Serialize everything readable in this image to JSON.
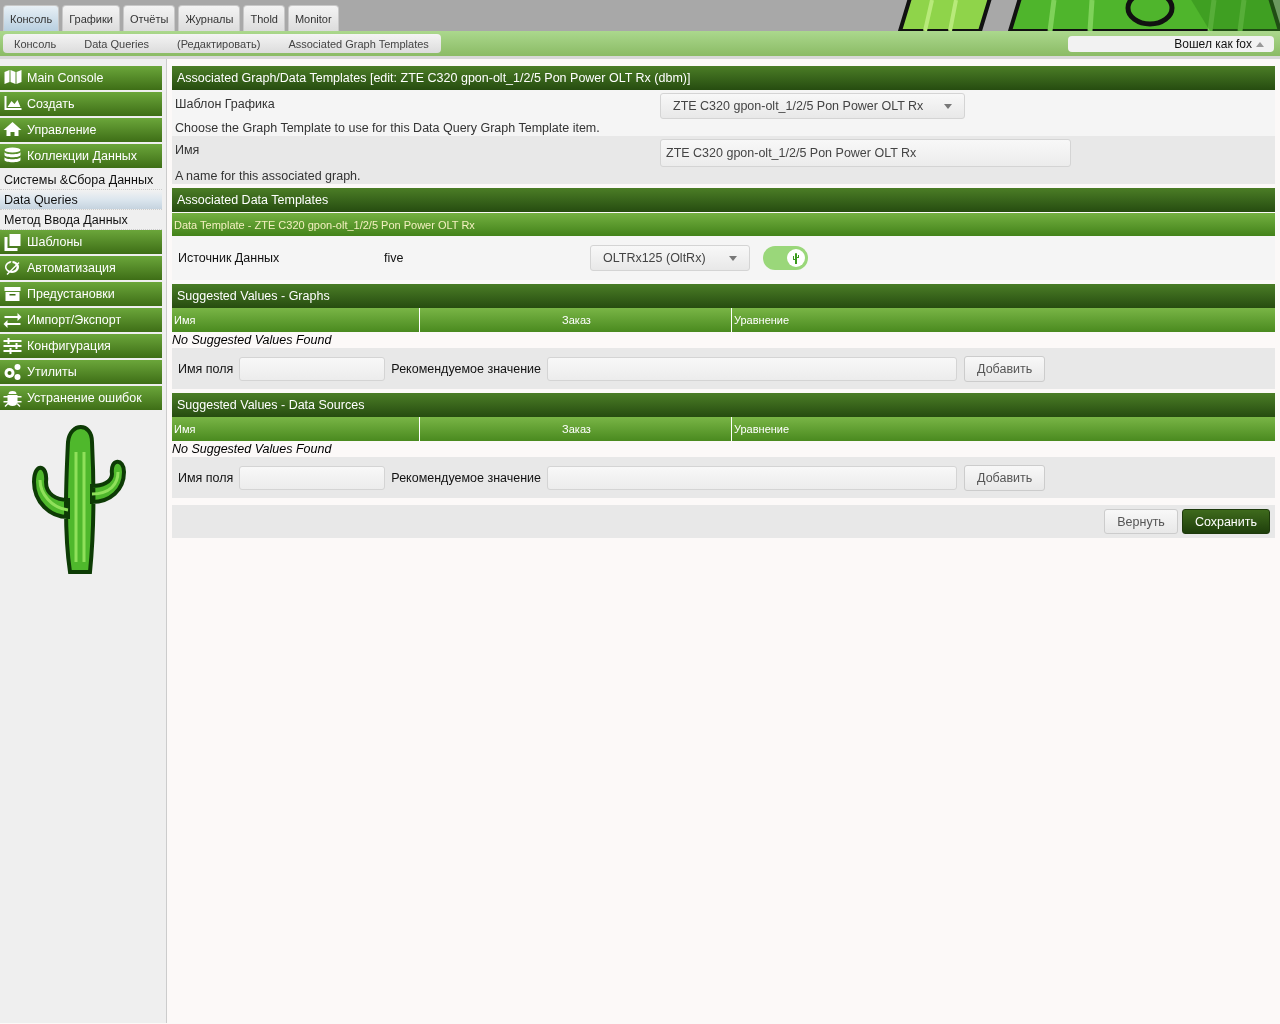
{
  "tabs": [
    {
      "label": "Консоль",
      "selected": true
    },
    {
      "label": "Графики",
      "selected": false
    },
    {
      "label": "Отчёты",
      "selected": false
    },
    {
      "label": "Журналы",
      "selected": false
    },
    {
      "label": "Thold",
      "selected": false
    },
    {
      "label": "Monitor",
      "selected": false
    }
  ],
  "breadcrumbs": [
    "Консоль",
    "Data Queries",
    "(Редактировать)",
    "Associated Graph Templates"
  ],
  "user_menu": {
    "label": "Вошел как fox"
  },
  "sidebar": {
    "items": [
      {
        "label": "Main Console",
        "kind": "header",
        "selected": false
      },
      {
        "label": "Создать",
        "kind": "header",
        "selected": false
      },
      {
        "label": "Управление",
        "kind": "header",
        "selected": false
      },
      {
        "label": "Коллекции Данных",
        "kind": "header",
        "selected": false
      },
      {
        "label": "Системы &Сбора Данных",
        "kind": "link",
        "selected": false
      },
      {
        "label": "Data Queries",
        "kind": "link",
        "selected": true
      },
      {
        "label": "Метод Ввода Данных",
        "kind": "link",
        "selected": false
      },
      {
        "label": "Шаблоны",
        "kind": "header",
        "selected": false
      },
      {
        "label": "Автоматизация",
        "kind": "header",
        "selected": false
      },
      {
        "label": "Предустановки",
        "kind": "header",
        "selected": false
      },
      {
        "label": "Импорт/Экспорт",
        "kind": "header",
        "selected": false
      },
      {
        "label": "Конфигурация",
        "kind": "header",
        "selected": false
      },
      {
        "label": "Утилиты",
        "kind": "header",
        "selected": false
      },
      {
        "label": "Устранение ошибок",
        "kind": "header",
        "selected": false
      }
    ]
  },
  "form": {
    "title": "Associated Graph/Data Templates [edit: ZTE C320 gpon-olt_1/2/5 Pon Power OLT Rx (dbm)]",
    "fields": [
      {
        "label": "Шаблон Графика",
        "description": "Choose the Graph Template to use for this Data Query Graph Template item.",
        "kind": "select",
        "value": "ZTE C320 gpon-olt_1/2/5 Pon Power OLT Rx"
      },
      {
        "label": "Имя",
        "description": "A name for this associated graph.",
        "kind": "text",
        "value": "ZTE C320 gpon-olt_1/2/5 Pon Power OLT Rx"
      }
    ]
  },
  "data_templates": {
    "title": "Associated Data Templates",
    "subtitle": "Data Template - ZTE C320 gpon-olt_1/2/5 Pon Power OLT Rx",
    "row": {
      "label": "Источник Данных",
      "value": "five",
      "select": "OLTRx125 (OltRx)",
      "on": true
    }
  },
  "suggested": [
    {
      "title": "Suggested Values - Graphs",
      "columns": [
        "Имя",
        "Заказ",
        "Уравнение"
      ],
      "empty": "No Suggested Values Found",
      "field_label": "Имя поля",
      "value_label": "Рекомендуемое значение",
      "button": "Добавить"
    },
    {
      "title": "Suggested Values - Data Sources",
      "columns": [
        "Имя",
        "Заказ",
        "Уравнение"
      ],
      "empty": "No Suggested Values Found",
      "field_label": "Имя поля",
      "value_label": "Рекомендуемое значение",
      "button": "Добавить"
    }
  ],
  "buttons": [
    {
      "label": "Вернуть",
      "kind": "secondary"
    },
    {
      "label": "Сохранить",
      "kind": "primary"
    }
  ]
}
